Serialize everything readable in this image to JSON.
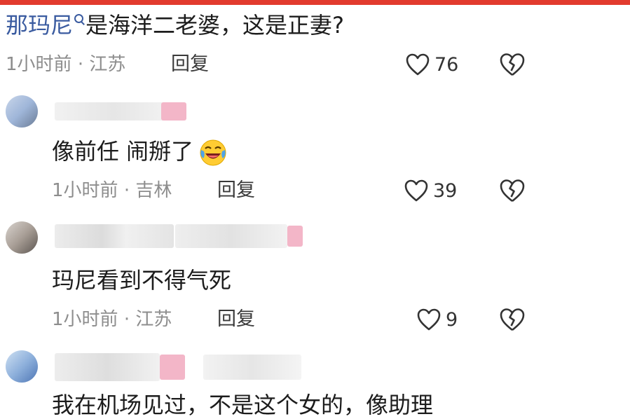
{
  "comments": [
    {
      "text_link": "那玛尼",
      "text_rest": "是海洋二老婆，这是正妻?",
      "time": "1小时前",
      "location": "江苏",
      "reply_label": "回复",
      "likes": "76"
    },
    {
      "text": "像前任 闹掰了",
      "emoji": "laughing-crying-emoji",
      "time": "1小时前",
      "location": "吉林",
      "reply_label": "回复",
      "likes": "39"
    },
    {
      "text": "玛尼看到不得气死",
      "time": "1小时前",
      "location": "江苏",
      "reply_label": "回复",
      "likes": "9"
    },
    {
      "text": "我在机场见过，不是这个女的，像助理"
    }
  ],
  "separator": "·",
  "icons": {
    "search": "search-icon",
    "like": "heart-icon",
    "dislike": "broken-heart-icon"
  },
  "colors": {
    "top_bar": "#e23b2e",
    "link": "#3a5ba0",
    "meta": "#8d8d8d",
    "text": "#1c1c1c"
  }
}
